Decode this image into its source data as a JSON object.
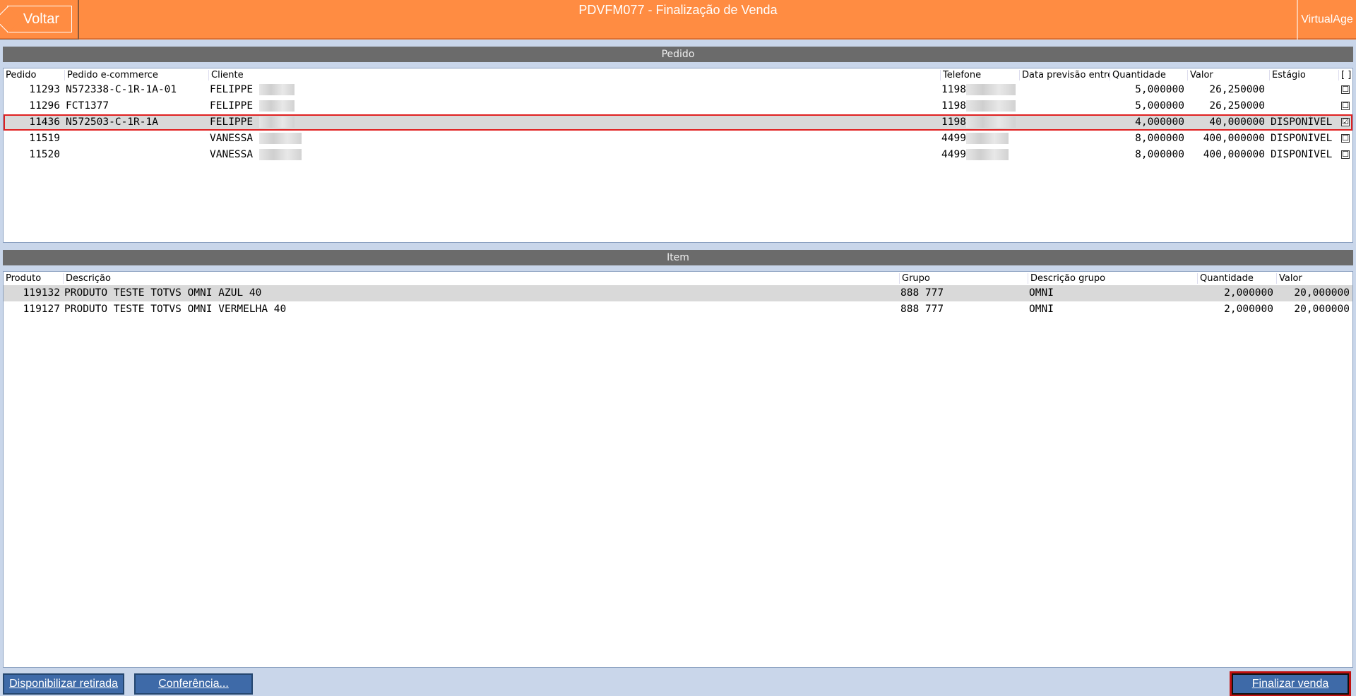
{
  "header": {
    "back_label": "Voltar",
    "title": "PDVFM077 - Finalização de Venda",
    "brand": "VirtualAge"
  },
  "pedido": {
    "section_title": "Pedido",
    "columns": [
      "Pedido",
      "Pedido e-commerce",
      "Cliente",
      "Telefone",
      "Data previsão entre",
      "Quantidade",
      "Valor",
      "Estágio",
      "[ ]"
    ],
    "rows": [
      {
        "pedido": "11293",
        "ecommerce": "N572338-C-1R-1A-01",
        "cliente": "FELIPPE",
        "telefone": "1198",
        "data": "",
        "quantidade": "5,000000",
        "valor": "26,250000",
        "estagio": "",
        "checked": "☐"
      },
      {
        "pedido": "11296",
        "ecommerce": "FCT1377",
        "cliente": "FELIPPE",
        "telefone": "1198",
        "data": "",
        "quantidade": "5,000000",
        "valor": "26,250000",
        "estagio": "",
        "checked": "☐"
      },
      {
        "pedido": "11436",
        "ecommerce": "N572503-C-1R-1A",
        "cliente": "FELIPPE",
        "telefone": "1198",
        "data": "",
        "quantidade": "4,000000",
        "valor": "40,000000",
        "estagio": "DISPONÍVEL",
        "checked": "☑"
      },
      {
        "pedido": "11519",
        "ecommerce": "",
        "cliente": "VANESSA",
        "telefone": "4499",
        "data": "",
        "quantidade": "8,000000",
        "valor": "400,000000",
        "estagio": "DISPONÍVEL",
        "checked": "☐"
      },
      {
        "pedido": "11520",
        "ecommerce": "",
        "cliente": "VANESSA",
        "telefone": "4499",
        "data": "",
        "quantidade": "8,000000",
        "valor": "400,000000",
        "estagio": "DISPONÍVEL",
        "checked": "☐"
      }
    ]
  },
  "item": {
    "section_title": "Item",
    "columns": [
      "Produto",
      "Descrição",
      "Grupo",
      "Descrição grupo",
      "Quantidade",
      "Valor"
    ],
    "rows": [
      {
        "produto": "119132",
        "descricao": "PRODUTO TESTE TOTVS OMNI AZUL 40",
        "grupo": "888 777",
        "desc_grupo": "OMNI",
        "quantidade": "2,000000",
        "valor": "20,000000"
      },
      {
        "produto": "119127",
        "descricao": "PRODUTO TESTE TOTVS OMNI VERMELHA 40",
        "grupo": "888 777",
        "desc_grupo": "OMNI",
        "quantidade": "2,000000",
        "valor": "20,000000"
      }
    ]
  },
  "footer": {
    "disponibilizar_label": "Disponibilizar retirada",
    "conferencia_label": "Conferência...",
    "finalizar_label": "Finalizar venda"
  },
  "colors": {
    "header_bg": "#ff8c42",
    "section_bar": "#6b6b6b",
    "button_bg": "#3e6aa8",
    "highlight": "#e02020"
  }
}
